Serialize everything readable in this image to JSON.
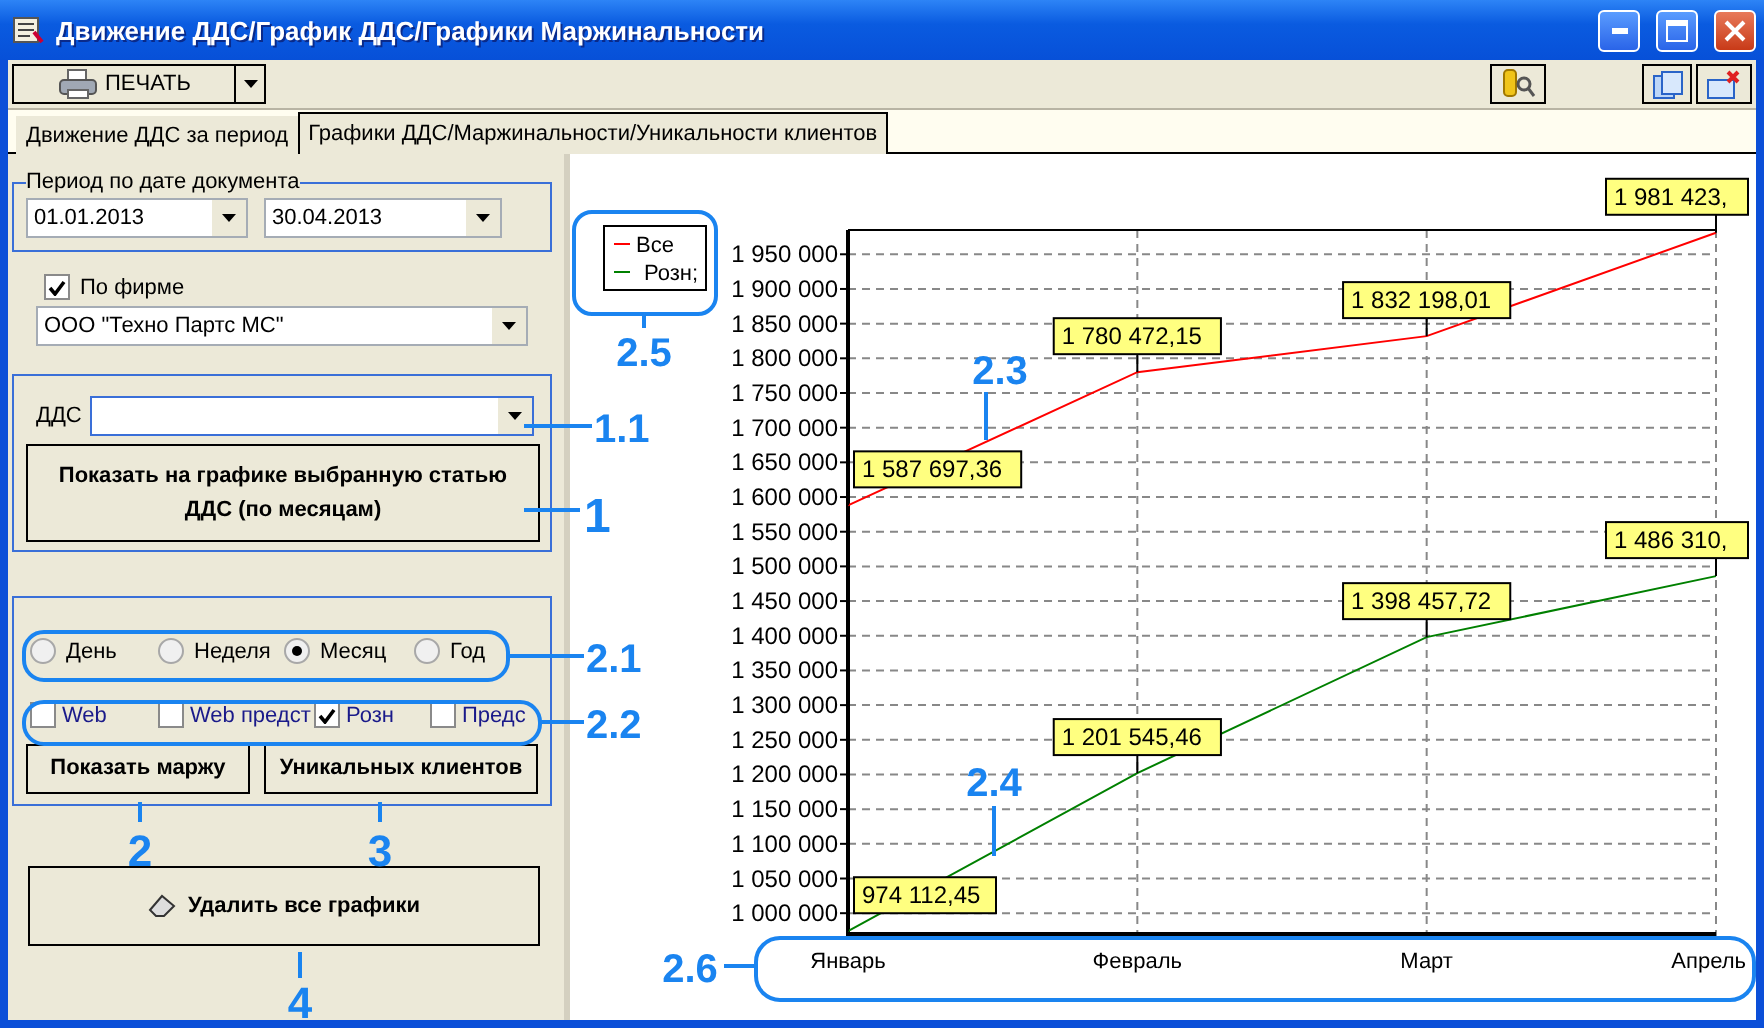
{
  "window": {
    "title": "Движение ДДС/График ДДС/Графики Маржинальности"
  },
  "toolbar": {
    "print_button": "ПЕЧАТЬ"
  },
  "tabs": [
    {
      "label": "Движение ДДС за период",
      "selected": false
    },
    {
      "label": "Графики ДДС/Маржинальности/Уникальности клиентов",
      "selected": true
    }
  ],
  "period": {
    "title": "Период по дате документа",
    "date_from": "01.01.2013",
    "date_to": "30.04.2013"
  },
  "firm_filter": {
    "label": "По фирме",
    "checked": true,
    "value": "ООО \"Техно Партс МС\""
  },
  "dds": {
    "label": "ДДС",
    "show_button": "Показать на графике выбранную статью\nДДС   (по месяцам)"
  },
  "period_radios": [
    {
      "label": "День",
      "selected": false
    },
    {
      "label": "Неделя",
      "selected": false
    },
    {
      "label": "Месяц",
      "selected": true
    },
    {
      "label": "Год",
      "selected": false
    }
  ],
  "channels": [
    {
      "label": "Web",
      "checked": false
    },
    {
      "label": "Web предст",
      "checked": false
    },
    {
      "label": "Розн",
      "checked": true
    },
    {
      "label": "Предс",
      "checked": false
    }
  ],
  "buttons": {
    "margin": "Показать маржу",
    "unique_clients": "Уникальных клиентов",
    "clear": "Удалить все графики"
  },
  "chart": {
    "chart_data": {
      "type": "line",
      "grid": true,
      "legend": true,
      "categories": [
        "Январь",
        "Февраль",
        "Март",
        "Апрель"
      ],
      "series": [
        {
          "name": "Все",
          "color": "#ff0000",
          "values": [
            1588000,
            1780000,
            1832000,
            1981000
          ]
        },
        {
          "name": "Розн;",
          "color": "#008000",
          "values": [
            974000,
            1202000,
            1398000,
            1486000
          ]
        }
      ],
      "ylim": [
        970000,
        1985000
      ],
      "yticks": [
        {
          "value": 1000000,
          "label": "1 000 000"
        },
        {
          "value": 1050000,
          "label": "1 050 000"
        },
        {
          "value": 1100000,
          "label": "1 100 000"
        },
        {
          "value": 1150000,
          "label": "1 150 000"
        },
        {
          "value": 1200000,
          "label": "1 200 000"
        },
        {
          "value": 1250000,
          "label": "1 250 000"
        },
        {
          "value": 1300000,
          "label": "1 300 000"
        },
        {
          "value": 1350000,
          "label": "1 350 000"
        },
        {
          "value": 1400000,
          "label": "1 400 000"
        },
        {
          "value": 1450000,
          "label": "1 450 000"
        },
        {
          "value": 1500000,
          "label": "1 500 000"
        },
        {
          "value": 1550000,
          "label": "1 550 000"
        },
        {
          "value": 1600000,
          "label": "1 600 000"
        },
        {
          "value": 1650000,
          "label": "1 650 000"
        },
        {
          "value": 1700000,
          "label": "1 700 000"
        },
        {
          "value": 1750000,
          "label": "1 750 000"
        },
        {
          "value": 1800000,
          "label": "1 800 000"
        },
        {
          "value": 1850000,
          "label": "1 850 000"
        },
        {
          "value": 1900000,
          "label": "1 900 000"
        },
        {
          "value": 1950000,
          "label": "1 950 000"
        }
      ],
      "value_labels": [
        [
          "1 587 697,36",
          "1 780 472,15",
          "1 832 198,01",
          "1 981 423,"
        ],
        [
          "974 112,45",
          "1 201 545,46",
          "1 398 457,72",
          "1 486 310,"
        ]
      ]
    }
  },
  "callouts": [
    {
      "label": "2.5"
    },
    {
      "label": "2.3"
    },
    {
      "label": "1.1"
    },
    {
      "label": "1"
    },
    {
      "label": "2.1"
    },
    {
      "label": "2.2"
    },
    {
      "label": "2"
    },
    {
      "label": "3"
    },
    {
      "label": "2.4"
    },
    {
      "label": "4"
    },
    {
      "label": "2.6"
    }
  ]
}
